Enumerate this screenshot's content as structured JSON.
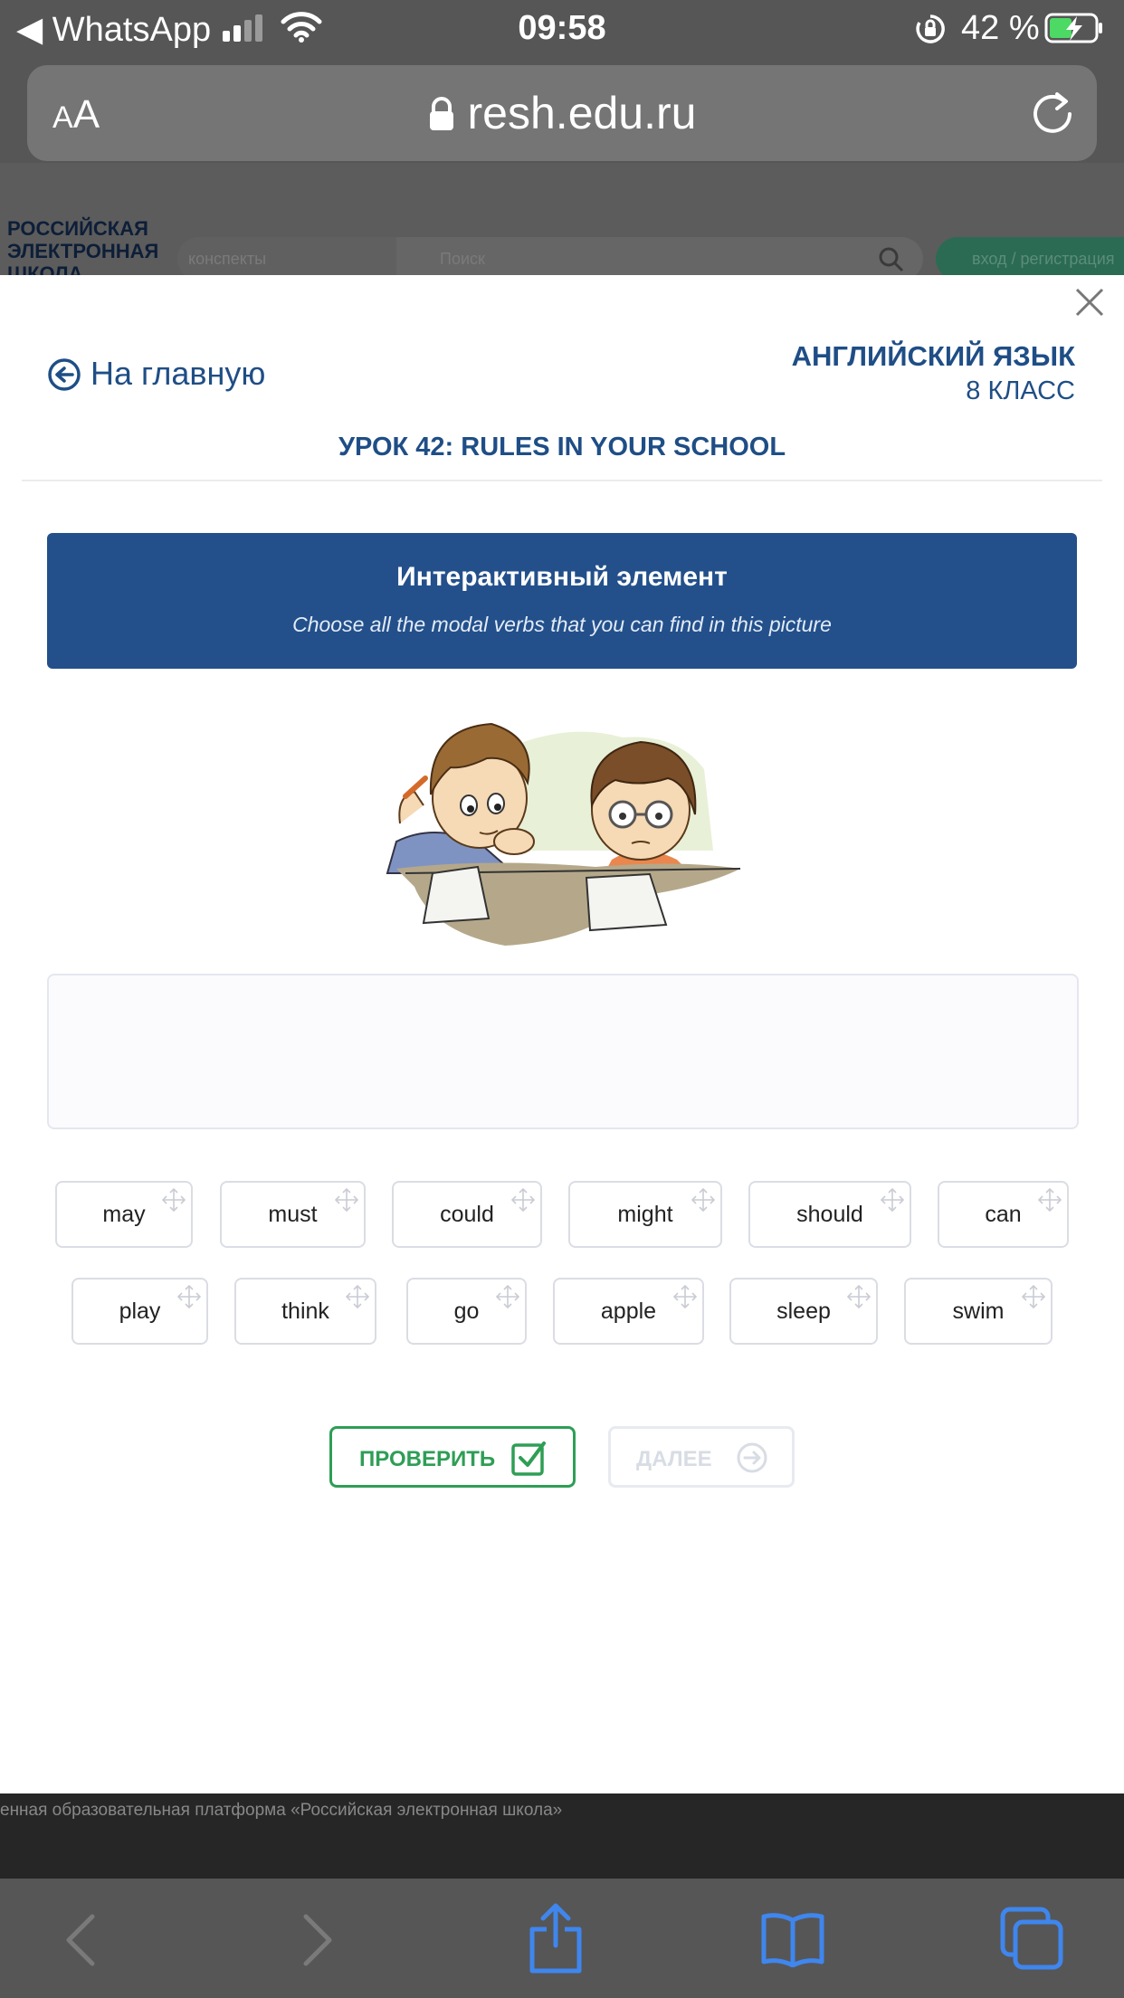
{
  "status_bar": {
    "back_app": "◀ WhatsApp",
    "time": "09:58",
    "battery_percent": "42 %"
  },
  "browser": {
    "text_size_label": "AA",
    "url": "resh.edu.ru"
  },
  "background_page": {
    "logo_lines": [
      "РОССИЙСКАЯ",
      "ЭЛЕКТРОННАЯ",
      "ШКОЛА"
    ],
    "filter_placeholder": "конспекты",
    "search_placeholder": "Поиск",
    "login_label": "вход / регистрация",
    "footer_text": "енная образовательная платформа «Российская электронная школа»"
  },
  "modal": {
    "home_link": "На главную",
    "subject": "АНГЛИЙСКИЙ ЯЗЫК",
    "grade": "8 КЛАСС",
    "lesson_title": "УРОК 42: RULES IN YOUR SCHOOL",
    "banner_title": "Интерактивный элемент",
    "banner_instruction": "Choose all the modal verbs that you can find in this picture",
    "words_row1": [
      "may",
      "must",
      "could",
      "might",
      "should",
      "can"
    ],
    "words_row2": [
      "play",
      "think",
      "go",
      "apple",
      "sleep",
      "swim"
    ],
    "check_button": "ПРОВЕРИТЬ",
    "next_button": "ДАЛЕЕ"
  },
  "colors": {
    "brand_blue": "#23508b",
    "check_green": "#2e9e55"
  }
}
